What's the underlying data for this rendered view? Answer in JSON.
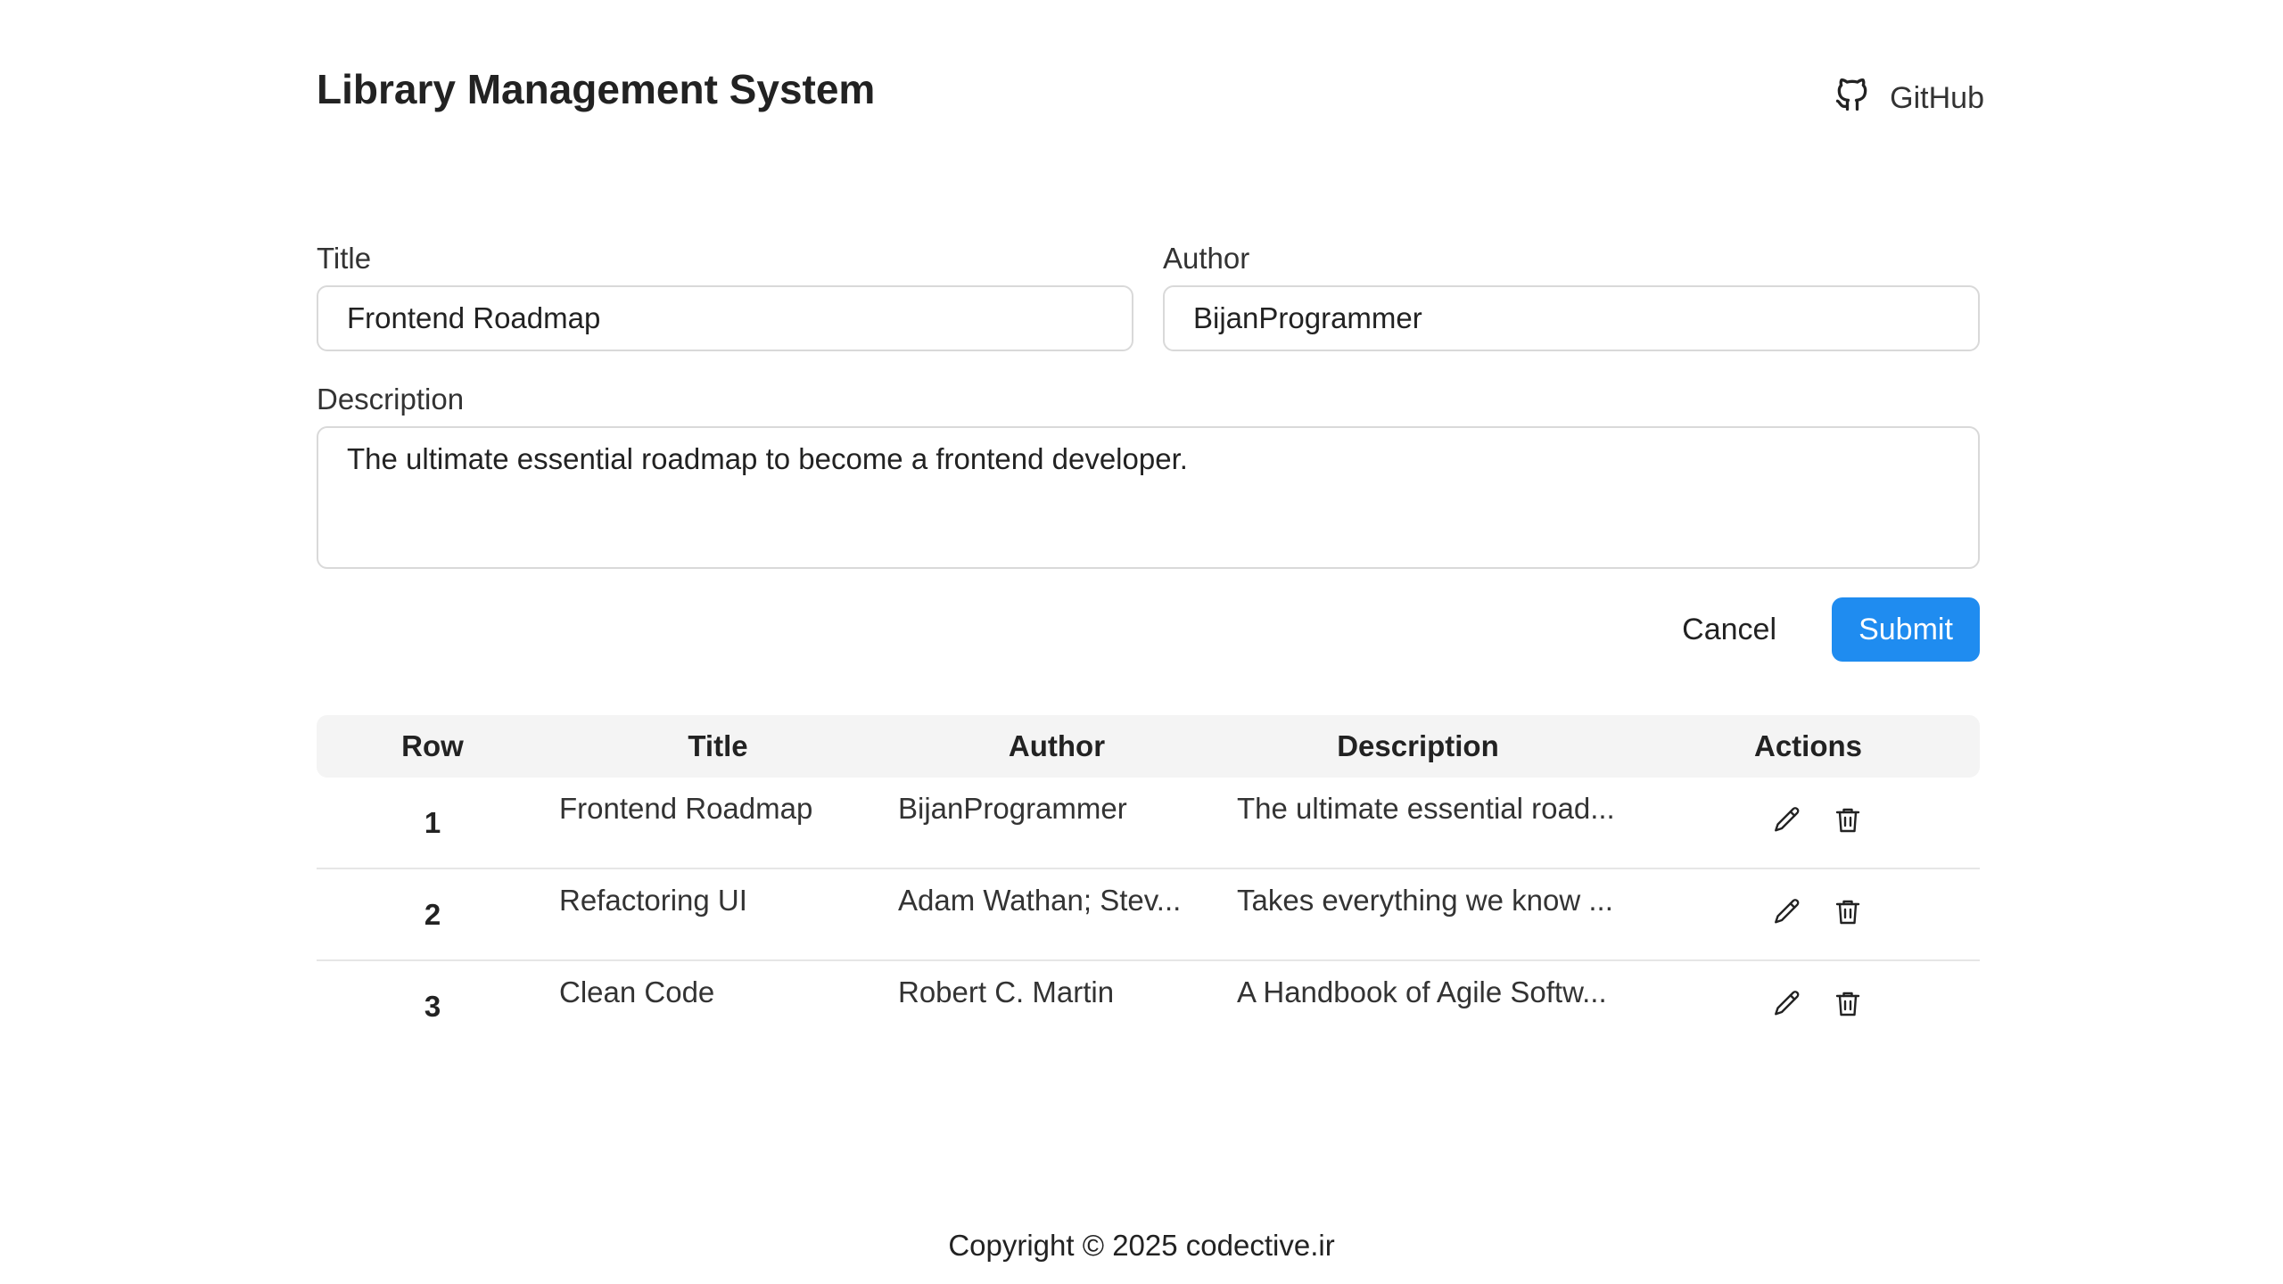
{
  "header": {
    "app_title": "Library Management System",
    "github_label": "GitHub"
  },
  "form": {
    "title_label": "Title",
    "title_value": "Frontend Roadmap",
    "author_label": "Author",
    "author_value": "BijanProgrammer",
    "description_label": "Description",
    "description_value": "The ultimate essential roadmap to become a frontend developer.",
    "cancel_label": "Cancel",
    "submit_label": "Submit"
  },
  "table": {
    "headers": {
      "row": "Row",
      "title": "Title",
      "author": "Author",
      "description": "Description",
      "actions": "Actions"
    },
    "rows": [
      {
        "row": "1",
        "title": "Frontend Roadmap",
        "author": "BijanProgrammer",
        "description": "The ultimate essential road..."
      },
      {
        "row": "2",
        "title": "Refactoring UI",
        "author": "Adam Wathan; Stev...",
        "description": "Takes everything we know ..."
      },
      {
        "row": "3",
        "title": "Clean Code",
        "author": "Robert C. Martin",
        "description": "A Handbook of Agile Softw..."
      }
    ]
  },
  "footer": {
    "copyright": "Copyright © 2025 codective.ir"
  },
  "icons": {
    "github": "github-icon",
    "edit": "pencil-icon",
    "delete": "trash-icon"
  },
  "colors": {
    "accent": "#1f8cf0",
    "table_header_bg": "#f4f4f4",
    "border": "#d9d9d9"
  }
}
